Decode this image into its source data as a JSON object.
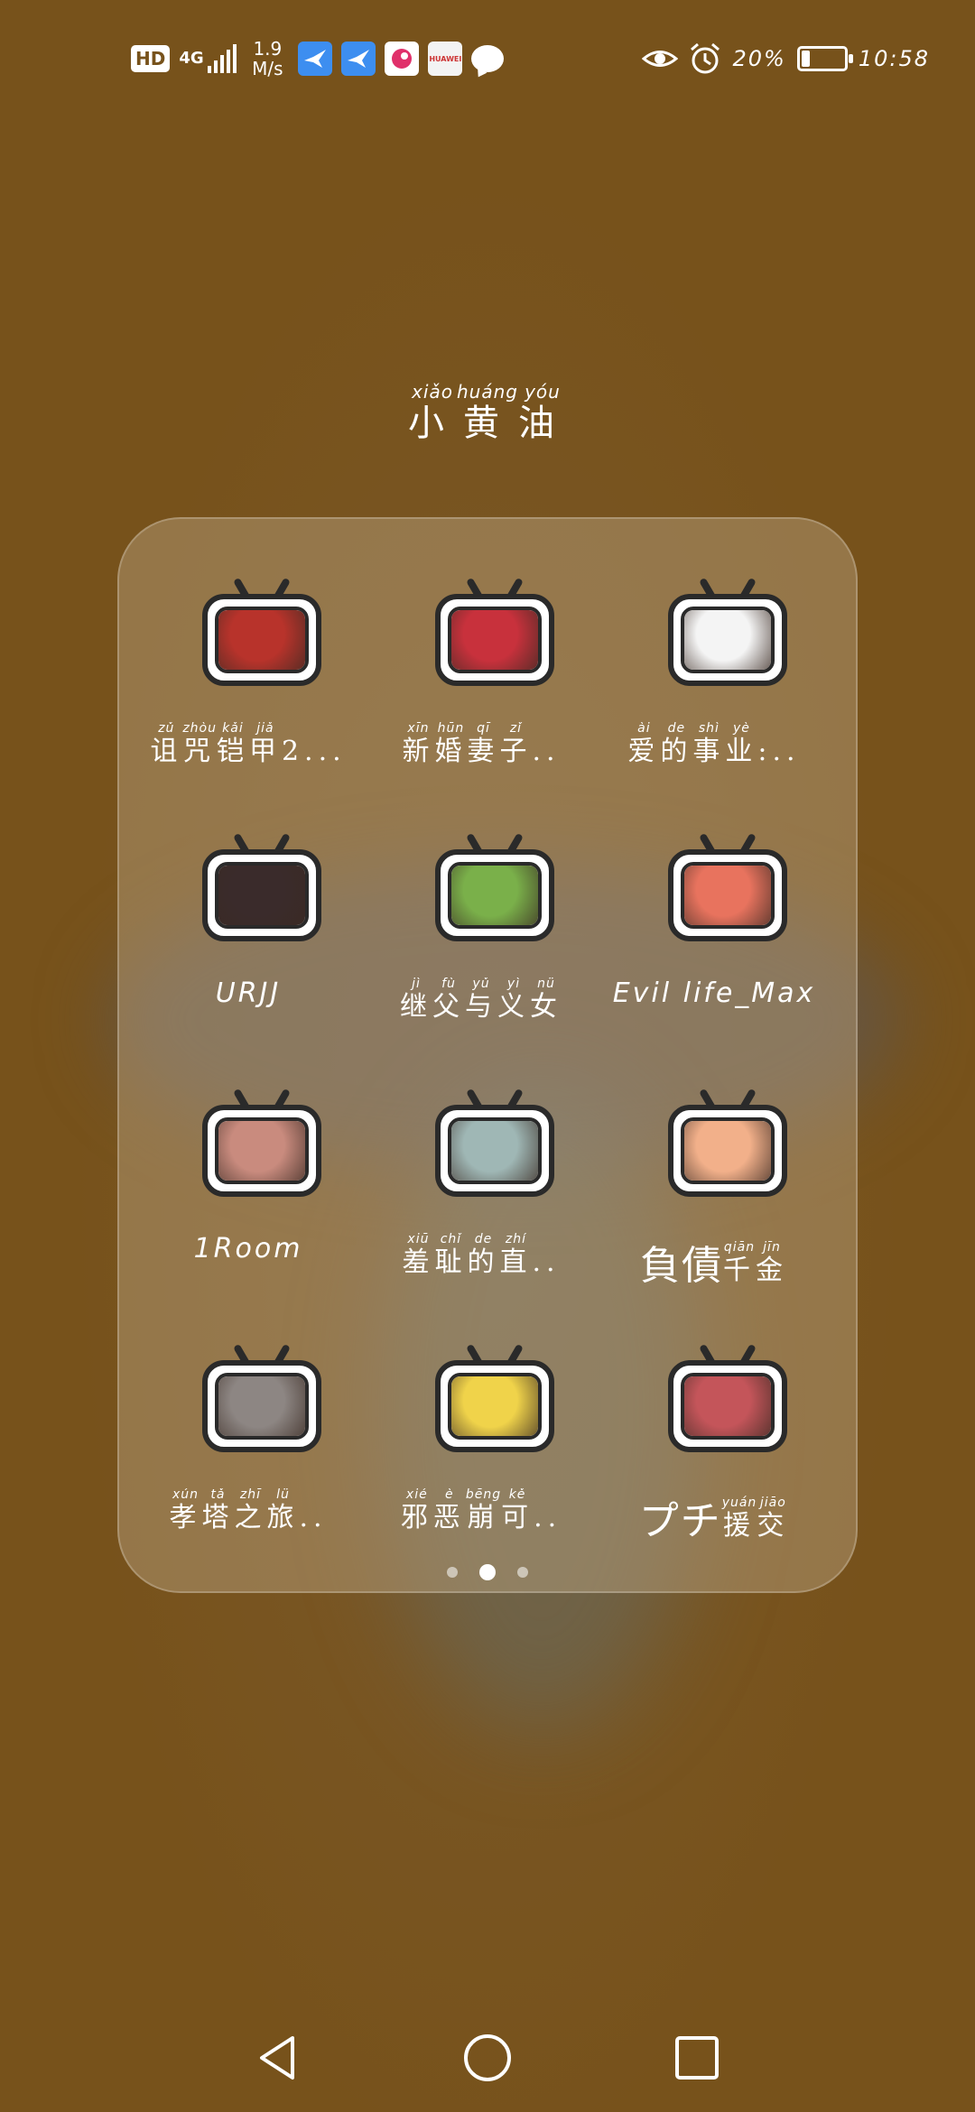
{
  "status_bar": {
    "hd": "HD",
    "network": "4G",
    "speed_value": "1.9",
    "speed_unit": "M/s",
    "battery_percent": "20%",
    "battery_level": 0.2,
    "time": "10:58",
    "notification_icons": [
      "bird-app-icon",
      "bird-app-icon",
      "pink-app-icon",
      "huawei-app-icon",
      "chat-icon"
    ],
    "huawei_text": "HUAWEI"
  },
  "folder": {
    "title_chars": [
      {
        "char": "小",
        "pinyin": "xiǎo"
      },
      {
        "char": "黄",
        "pinyin": "huáng"
      },
      {
        "char": "油",
        "pinyin": "yóu"
      }
    ]
  },
  "apps": [
    {
      "ruby": [
        {
          "c": "诅",
          "p": "zǔ"
        },
        {
          "c": "咒",
          "p": "zhòu"
        },
        {
          "c": "铠",
          "p": "kǎi"
        },
        {
          "c": "甲",
          "p": "jiǎ"
        }
      ],
      "suffix": "2...",
      "plain": "",
      "art_color": "#b8332b"
    },
    {
      "ruby": [
        {
          "c": "新",
          "p": "xīn"
        },
        {
          "c": "婚",
          "p": "hūn"
        },
        {
          "c": "妻",
          "p": "qī"
        },
        {
          "c": "子",
          "p": "zǐ"
        }
      ],
      "suffix": "..",
      "plain": "",
      "art_color": "#c8313c"
    },
    {
      "ruby": [
        {
          "c": "爱",
          "p": "ài"
        },
        {
          "c": "的",
          "p": "de"
        },
        {
          "c": "事",
          "p": "shì"
        },
        {
          "c": "业",
          "p": "yè"
        }
      ],
      "suffix": ":..",
      "plain": "",
      "art_color": "#f4f4f4"
    },
    {
      "ruby": [],
      "suffix": "",
      "plain": "URJJ",
      "art_color": "#3a2b2b"
    },
    {
      "ruby": [
        {
          "c": "继",
          "p": "jì"
        },
        {
          "c": "父",
          "p": "fù"
        },
        {
          "c": "与",
          "p": "yǔ"
        },
        {
          "c": "义",
          "p": "yì"
        },
        {
          "c": "女",
          "p": "nǚ"
        }
      ],
      "suffix": "",
      "plain": "",
      "art_color": "#7ab04a"
    },
    {
      "ruby": [],
      "suffix": "",
      "plain": "Evil life_Max",
      "art_color": "#e8735e"
    },
    {
      "ruby": [],
      "suffix": "",
      "plain": "1Room",
      "art_color": "#c98b7e"
    },
    {
      "ruby": [
        {
          "c": "羞",
          "p": "xiū"
        },
        {
          "c": "耻",
          "p": "chǐ"
        },
        {
          "c": "的",
          "p": "de"
        },
        {
          "c": "直",
          "p": "zhí"
        }
      ],
      "suffix": "..",
      "plain": "",
      "art_color": "#9fb7b5"
    },
    {
      "ruby": [
        {
          "c": "千",
          "p": "qiān"
        },
        {
          "c": "金",
          "p": "jīn"
        }
      ],
      "prefix": "負債",
      "suffix": "",
      "plain": "",
      "art_color": "#f2b08a"
    },
    {
      "ruby": [
        {
          "c": "孝",
          "p": "xún"
        },
        {
          "c": "塔",
          "p": "tǎ"
        },
        {
          "c": "之",
          "p": "zhī"
        },
        {
          "c": "旅",
          "p": "lǚ"
        }
      ],
      "suffix": "..",
      "plain": "",
      "art_color": "#8d8683"
    },
    {
      "ruby": [
        {
          "c": "邪",
          "p": "xié"
        },
        {
          "c": "恶",
          "p": "è"
        },
        {
          "c": "崩",
          "p": "bēng"
        },
        {
          "c": "可",
          "p": "kě"
        }
      ],
      "suffix": "..",
      "plain": "",
      "art_color": "#f0d34a"
    },
    {
      "ruby": [
        {
          "c": "援",
          "p": "yuán"
        },
        {
          "c": "交",
          "p": "jiāo"
        }
      ],
      "prefix": "プチ",
      "suffix": "",
      "plain": "",
      "art_color": "#c4555a"
    }
  ],
  "page_indicator": {
    "count": 3,
    "active": 1
  },
  "nav": {
    "back": "back-icon",
    "home": "home-icon",
    "recent": "recent-apps-icon"
  }
}
